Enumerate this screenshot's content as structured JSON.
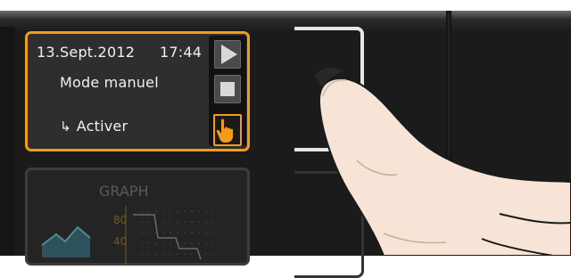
{
  "active_tile": {
    "date": "13.Sept.2012",
    "time": "17:44",
    "mode": "Mode manuel",
    "action": "Activer",
    "action_arrow": "↳"
  },
  "controls": {
    "play_icon": "play-icon",
    "stop_icon": "stop-icon",
    "hand_icon": "tap-hand-icon"
  },
  "graph_tile": {
    "title": "GRAPH",
    "labels": [
      "80",
      "40"
    ]
  },
  "colors": {
    "accent": "#f29d1a",
    "device": "#1b1b1b",
    "text": "#f0f0f0",
    "skin": "#f7e4d6"
  }
}
